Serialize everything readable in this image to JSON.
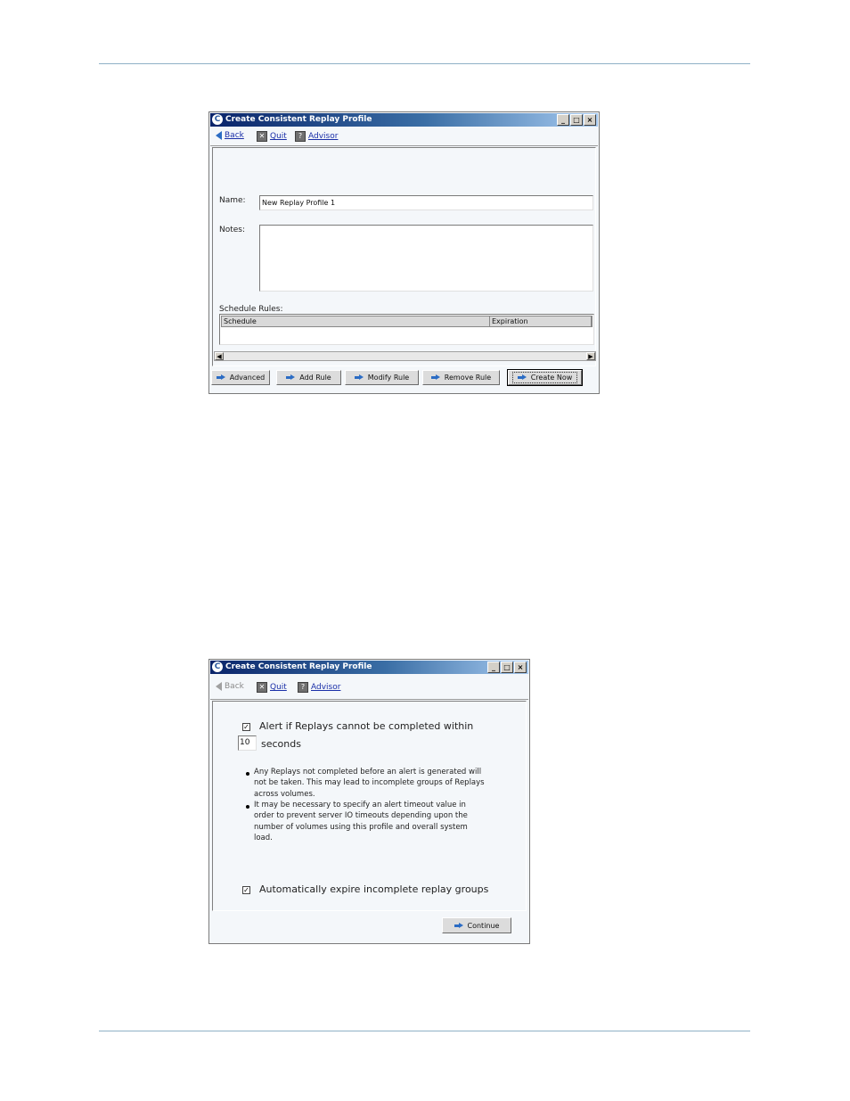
{
  "window1": {
    "title": "Create Consistent Replay Profile",
    "icon": "c-logo-icon",
    "toolbar": {
      "back": "Back",
      "quit": "Quit",
      "advisor": "Advisor"
    },
    "name_label": "Name:",
    "name_value": "New Replay Profile 1",
    "notes_label": "Notes:",
    "notes_value": "",
    "schedule_rules_label": "Schedule Rules:",
    "grid_columns": [
      "Schedule",
      "Expiration"
    ],
    "buttons": {
      "advanced": "Advanced",
      "add_rule": "Add Rule",
      "modify_rule": "Modify Rule",
      "remove_rule": "Remove Rule",
      "create_now": "Create Now"
    }
  },
  "window2": {
    "title": "Create Consistent Replay Profile",
    "icon": "c-logo-icon",
    "toolbar": {
      "back": "Back",
      "quit": "Quit",
      "advisor": "Advisor",
      "back_enabled": false
    },
    "alert_checkbox_label": "Alert if Replays cannot be completed within",
    "alert_checked": true,
    "timeout_value": "10",
    "seconds_label": "seconds",
    "notes": [
      "Any Replays not completed before an alert is generated will not be taken. This may lead to incomplete groups of Replays across volumes.",
      "It may be necessary to specify an alert timeout value in order to prevent server IO timeouts depending upon the number of volumes using this profile and overall system load."
    ],
    "expire_checkbox_label": "Automatically expire incomplete replay groups",
    "expire_checked": true,
    "continue_button": "Continue"
  },
  "colors": {
    "accent": "#2b6cc4",
    "rule": "#8fb1c6",
    "titlebar_dark": "#0a246a",
    "link": "#1a2fa8"
  }
}
